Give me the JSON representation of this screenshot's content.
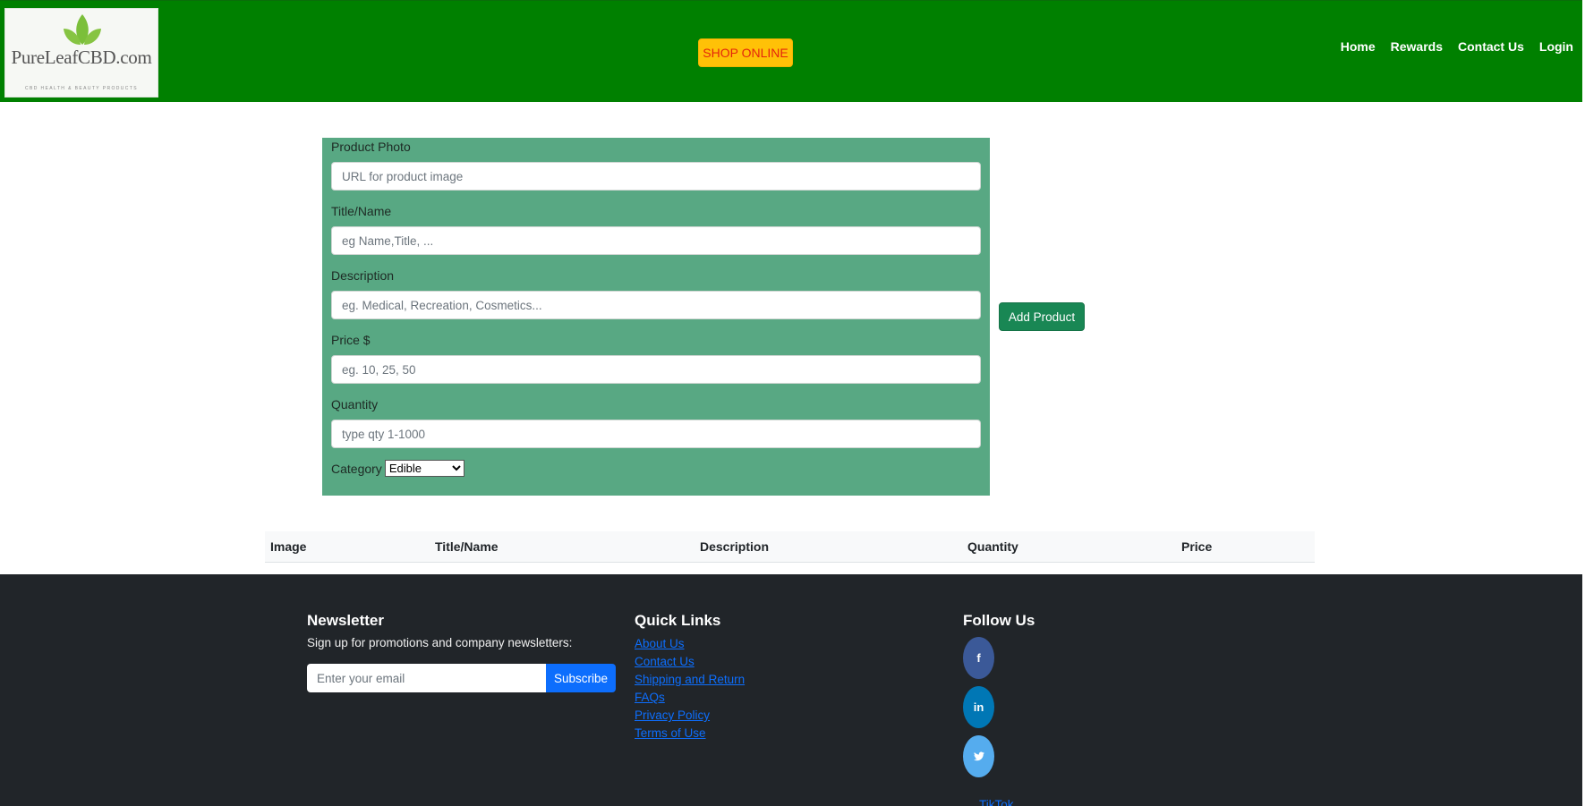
{
  "header": {
    "logo": {
      "brand": "PureLeafCBD.com",
      "tagline": "CBD HEALTH & BEAUTY PRODUCTS"
    },
    "shop_button": "SHOP ONLINE",
    "nav": [
      "Home",
      "Rewards",
      "Contact Us",
      "Login"
    ],
    "colors": {
      "background": "#008000",
      "shop_button": "#ffc107",
      "shop_text": "#e4260c"
    }
  },
  "form": {
    "photo": {
      "label": "Product Photo",
      "placeholder": "URL for product image"
    },
    "title": {
      "label": "Title/Name",
      "placeholder": "eg Name,Title, ..."
    },
    "description": {
      "label": "Description",
      "placeholder": "eg. Medical, Recreation, Cosmetics..."
    },
    "price": {
      "label": "Price $",
      "placeholder": "eg. 10, 25, 50"
    },
    "quantity": {
      "label": "Quantity",
      "placeholder": "type qty 1-1000"
    },
    "category": {
      "label": "Category",
      "selected": "Edible"
    },
    "add_button": "Add Product",
    "colors": {
      "panel": "#58a883",
      "add_button": "#198754"
    }
  },
  "table": {
    "columns": [
      "Image",
      "Title/Name",
      "Description",
      "Quantity",
      "Price"
    ]
  },
  "footer": {
    "newsletter": {
      "heading": "Newsletter",
      "text": "Sign up for promotions and company newsletters:",
      "placeholder": "Enter your email",
      "button": "Subscribe"
    },
    "quick_links": {
      "heading": "Quick Links",
      "links": [
        "About Us",
        "Contact Us",
        "Shipping and Return",
        "FAQs",
        "Privacy Policy",
        "Terms of Use"
      ]
    },
    "follow_us": {
      "heading": "Follow Us",
      "icons": [
        "facebook-icon",
        "linkedin-icon",
        "twitter-icon"
      ],
      "tiktok": "TikTok"
    },
    "colors": {
      "background": "#212529",
      "facebook": "#3b5998",
      "linkedin": "#0077b5",
      "twitter": "#55acee",
      "subscribe": "#0d6efd"
    }
  }
}
